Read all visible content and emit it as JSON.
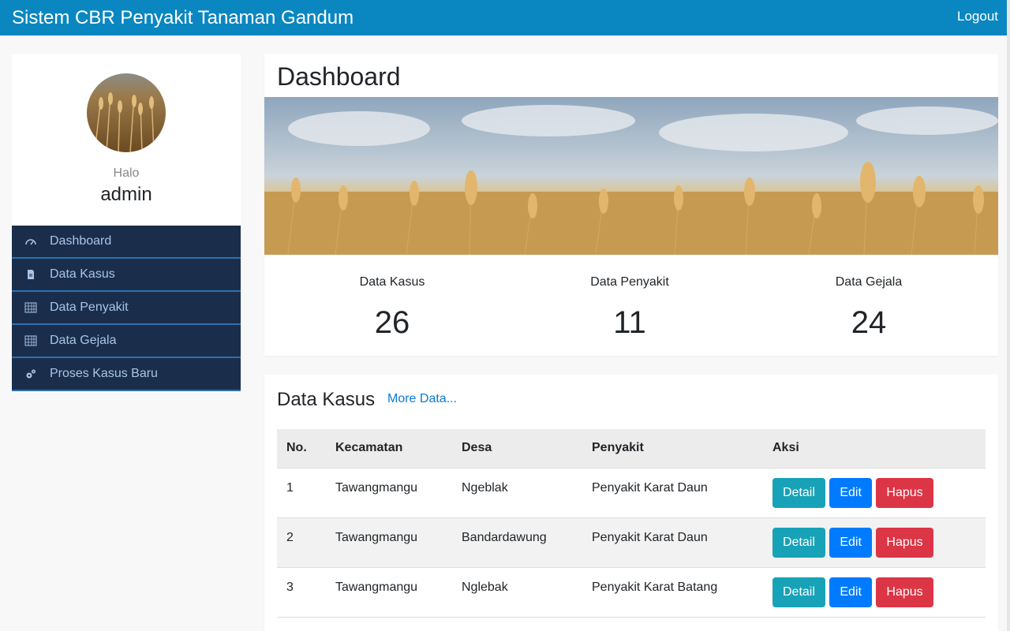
{
  "navbar": {
    "brand": "Sistem CBR Penyakit Tanaman Gandum",
    "logout": "Logout"
  },
  "sidebar": {
    "greeting": "Halo",
    "username": "admin",
    "items": [
      {
        "label": "Dashboard",
        "icon": "dashboard-gauge-icon"
      },
      {
        "label": "Data Kasus",
        "icon": "document-icon"
      },
      {
        "label": "Data Penyakit",
        "icon": "table-grid-icon"
      },
      {
        "label": "Data Gejala",
        "icon": "table-grid-icon"
      },
      {
        "label": "Proses Kasus Baru",
        "icon": "gears-icon"
      }
    ]
  },
  "dashboard": {
    "title": "Dashboard",
    "stats": [
      {
        "label": "Data Kasus",
        "value": "26"
      },
      {
        "label": "Data Penyakit",
        "value": "11"
      },
      {
        "label": "Data Gejala",
        "value": "24"
      }
    ]
  },
  "kasus": {
    "title": "Data Kasus",
    "more": "More Data...",
    "columns": [
      "No.",
      "Kecamatan",
      "Desa",
      "Penyakit",
      "Aksi"
    ],
    "rows": [
      {
        "no": "1",
        "kecamatan": "Tawangmangu",
        "desa": "Ngeblak",
        "penyakit": "Penyakit Karat Daun"
      },
      {
        "no": "2",
        "kecamatan": "Tawangmangu",
        "desa": "Bandardawung",
        "penyakit": "Penyakit Karat Daun"
      },
      {
        "no": "3",
        "kecamatan": "Tawangmangu",
        "desa": "Nglebak",
        "penyakit": "Penyakit Karat Batang"
      }
    ],
    "actions": {
      "detail": "Detail",
      "edit": "Edit",
      "hapus": "Hapus"
    }
  },
  "colors": {
    "navbar": "#0a87c0",
    "sidebar_menu": "#1a2e4c",
    "detail": "#17a2b8",
    "edit": "#007bff",
    "hapus": "#dc3545"
  }
}
